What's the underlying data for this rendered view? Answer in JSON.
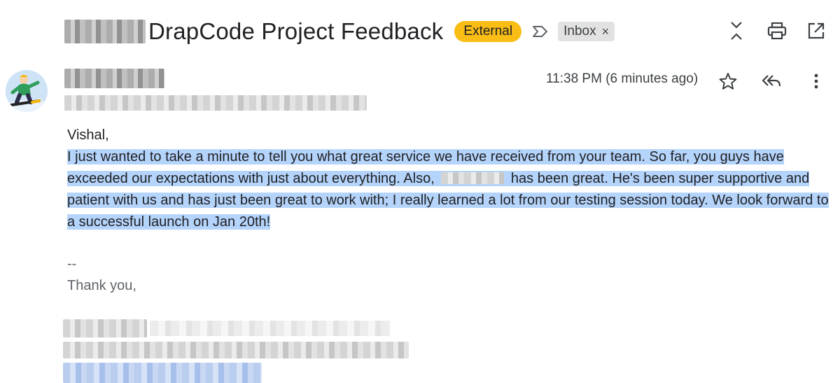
{
  "header": {
    "subject": "DrapCode Project Feedback",
    "badge_external": "External",
    "label_inbox": "Inbox",
    "label_remove": "×"
  },
  "message": {
    "time": "11:38 PM (6 minutes ago)",
    "greeting": "Vishal,",
    "body_part1": "I just wanted to take a minute to tell you what great service we have received from your team. So far, you guys have exceeded our expectations with just about everything. Also,",
    "body_part2": "has been great. He's been super supportive and patient with us and has just been great to work with; I really learned a lot from our testing session today. We look forward to a successful launch on Jan 20th!",
    "sig_separator": "--",
    "sig_thanks": "Thank you,"
  },
  "colors": {
    "external_badge": "#f9bd15",
    "selection_highlight": "#b5d4fb"
  },
  "icons": [
    "important-marker-icon",
    "expand-collapse-icon",
    "print-icon",
    "open-in-new-window-icon",
    "star-icon",
    "reply-all-icon",
    "more-vert-icon"
  ]
}
